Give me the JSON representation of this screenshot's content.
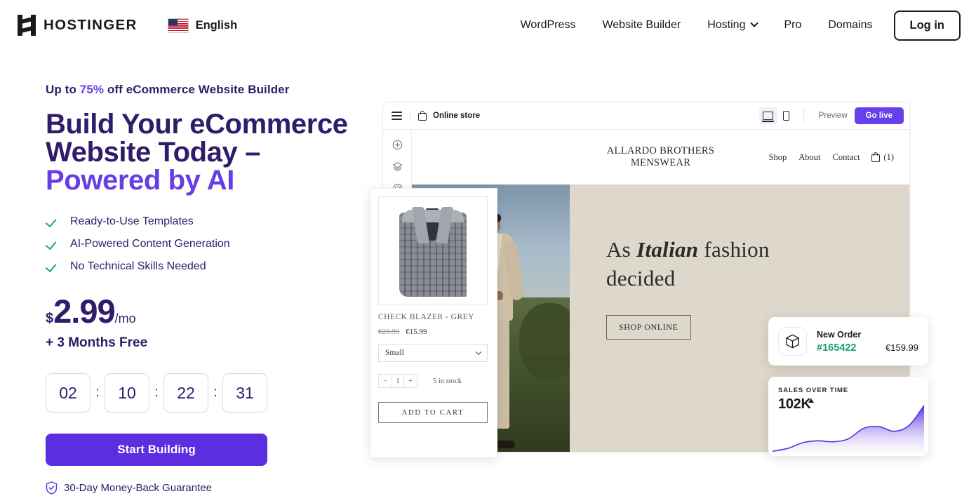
{
  "header": {
    "brand": "HOSTINGER",
    "language": "English",
    "nav": [
      {
        "label": "WordPress",
        "has_dropdown": false
      },
      {
        "label": "Website Builder",
        "has_dropdown": false
      },
      {
        "label": "Hosting",
        "has_dropdown": true
      },
      {
        "label": "Pro",
        "has_dropdown": false
      },
      {
        "label": "Domains",
        "has_dropdown": false
      }
    ],
    "login_label": "Log in"
  },
  "hero": {
    "eyebrow_pre": "Up to ",
    "eyebrow_pct": "75%",
    "eyebrow_post": " off eCommerce Website Builder",
    "title_line1": "Build Your eCommerce",
    "title_line2": "Website Today –",
    "title_line3": "Powered by AI",
    "features": [
      "Ready-to-Use Templates",
      "AI-Powered Content Generation",
      "No Technical Skills Needed"
    ],
    "currency": "$",
    "price": "2.99",
    "period": "/mo",
    "bonus": "+ 3 Months Free",
    "timer": {
      "days": "02",
      "hours": "10",
      "minutes": "22",
      "seconds": "31",
      "separator": ":"
    },
    "cta_label": "Start Building",
    "guarantee": "30-Day Money-Back Guarantee"
  },
  "editor": {
    "site_title": "Online store",
    "preview_label": "Preview",
    "golive_label": "Go live",
    "sidebar_icons": [
      "add-element-icon",
      "layers-icon",
      "palette-icon"
    ],
    "store": {
      "name_line1": "ALLARDO BROTHERS",
      "name_line2": "MENSWEAR",
      "links": [
        "Shop",
        "About",
        "Contact"
      ],
      "cart_count": "(1)"
    },
    "banner": {
      "text_pre": "As ",
      "text_em": "Italian",
      "text_post": " fashion",
      "text_line2": "decided",
      "button": "SHOP ONLINE"
    },
    "product": {
      "title": "CHECK BLAZER - GREY",
      "price_old": "€20.99",
      "price_new": "€15.99",
      "size": "Small",
      "qty_minus": "−",
      "qty_value": "1",
      "qty_plus": "+",
      "stock": "5 in stock",
      "add_to_cart": "ADD TO CART"
    }
  },
  "order_card": {
    "title": "New Order",
    "order_id": "#165422",
    "amount": "€159.99"
  },
  "chart_data": {
    "type": "area",
    "title": "SALES OVER TIME",
    "value_label": "102K",
    "trend": "up",
    "x": [
      0,
      1,
      2,
      3,
      4,
      5,
      6,
      7,
      8,
      9,
      10
    ],
    "values": [
      4,
      10,
      22,
      26,
      24,
      30,
      52,
      56,
      46,
      58,
      100
    ],
    "ylim": [
      0,
      100
    ],
    "grid": false,
    "legend": false,
    "line_color": "#5b2ee0",
    "fill_gradient": [
      "#5b2ee0",
      "#ffffff"
    ]
  },
  "colors": {
    "accent_purple": "#673de6",
    "cta_purple": "#5c2ee0",
    "heading_navy": "#2f1c6a",
    "check_green": "#18a87b",
    "order_green": "#1a9c6a",
    "banner_beige": "#ded7cb"
  }
}
